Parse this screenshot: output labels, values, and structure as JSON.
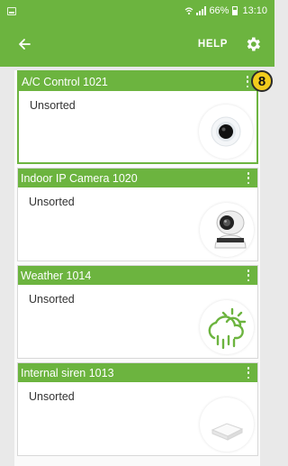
{
  "status_bar": {
    "battery_percent": "66%",
    "time": "13:10",
    "icons": [
      "notification-icon",
      "wifi-icon",
      "signal-icon",
      "battery-icon"
    ]
  },
  "app_bar": {
    "back_icon": "arrow-left-icon",
    "help_label": "HELP",
    "settings_icon": "gear-icon",
    "color": "#6cb43f"
  },
  "badge": {
    "value": "8",
    "color": "#f2cc1d"
  },
  "devices": [
    {
      "title": "A/C Control 1021",
      "subtitle": "Unsorted",
      "icon": "ac-sensor-icon",
      "selected": true
    },
    {
      "title": "Indoor IP Camera 1020",
      "subtitle": "Unsorted",
      "icon": "ip-camera-icon",
      "selected": false
    },
    {
      "title": "Weather 1014",
      "subtitle": "Unsorted",
      "icon": "weather-icon",
      "selected": false
    },
    {
      "title": "Internal siren 1013",
      "subtitle": "Unsorted",
      "icon": "siren-icon",
      "selected": false
    }
  ]
}
